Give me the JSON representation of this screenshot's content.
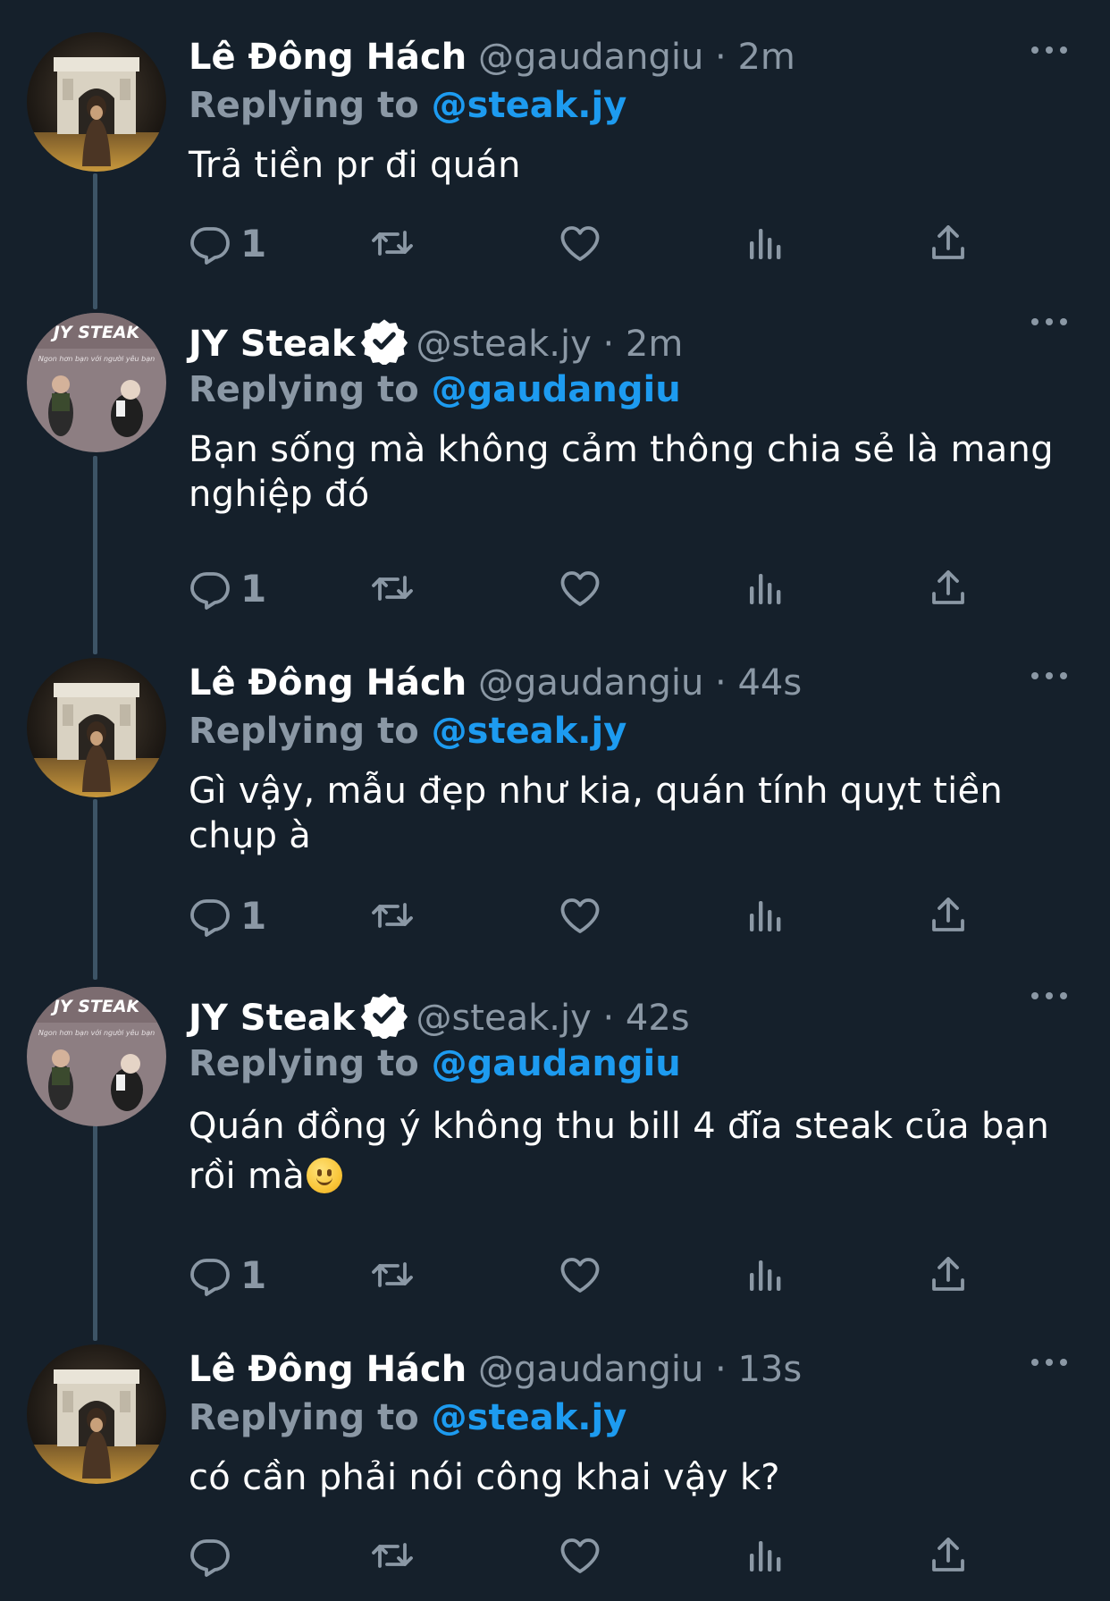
{
  "tweets": [
    {
      "name": "Lê Đông Hách",
      "handle": "@gaudangiu",
      "separator": "·",
      "time": "2m",
      "replying_label": "Replying to",
      "replying_to": "@steak.jy",
      "text": "Trả tiền pr đi quán",
      "reply_count": "1",
      "verified": false,
      "avatar": "arc-de-triomphe-photo"
    },
    {
      "name": "JY Steak",
      "handle": "@steak.jy",
      "separator": "·",
      "time": "2m",
      "replying_label": "Replying to",
      "replying_to": "@gaudangiu",
      "text": "Bạn sống mà không cảm thông chia sẻ là mang nghiệp đó",
      "reply_count": "1",
      "verified": true,
      "avatar": "jy-steak-logo"
    },
    {
      "name": "Lê Đông Hách",
      "handle": "@gaudangiu",
      "separator": "·",
      "time": "44s",
      "replying_label": "Replying to",
      "replying_to": "@steak.jy",
      "text": "Gì vậy, mẫu đẹp như kia, quán tính quỵt tiền chụp à",
      "reply_count": "1",
      "verified": false,
      "avatar": "arc-de-triomphe-photo"
    },
    {
      "name": "JY Steak",
      "handle": "@steak.jy",
      "separator": "·",
      "time": "42s",
      "replying_label": "Replying to",
      "replying_to": "@gaudangiu",
      "text": "Quán đồng ý không thu bill 4 đĩa steak của bạn rồi mà",
      "text_emoji": "slightly-smiling-face",
      "reply_count": "1",
      "verified": true,
      "avatar": "jy-steak-logo"
    },
    {
      "name": "Lê Đông Hách",
      "handle": "@gaudangiu",
      "separator": "·",
      "time": "13s",
      "replying_label": "Replying to",
      "replying_to": "@steak.jy",
      "text": "có cần phải nói công khai vậy k?",
      "reply_count": "",
      "verified": false,
      "avatar": "arc-de-triomphe-photo"
    }
  ],
  "avatar_text": {
    "logo_title": "JY STEAK",
    "logo_subtitle": "Ngon hơn bạn với người yêu bạn"
  },
  "colors": {
    "background": "#15202b",
    "text": "#ffffff",
    "muted": "#8b98a5",
    "accent": "#1d9bf0",
    "thread_line": "#3d5466"
  },
  "action_icons": [
    "reply-icon",
    "retweet-icon",
    "like-icon",
    "analytics-icon",
    "share-icon"
  ]
}
